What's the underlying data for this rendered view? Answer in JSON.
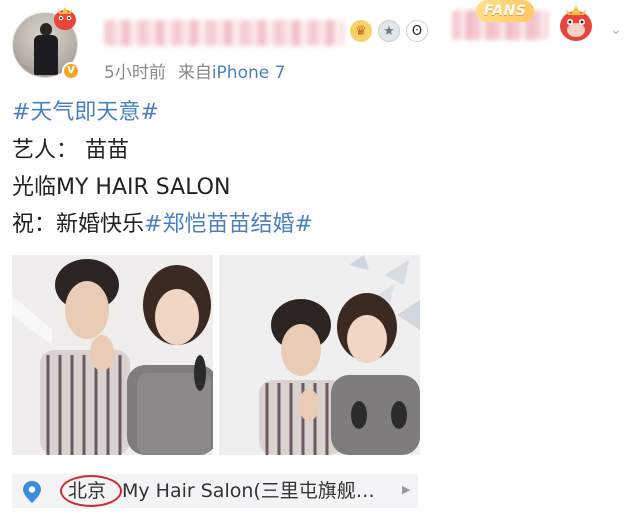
{
  "header": {
    "meta": {
      "time": "5小时前",
      "source_prefix": "来自",
      "source": "iPhone 7"
    },
    "fans_label": "FANS",
    "badges": [
      "crown-icon",
      "medal-icon",
      "panda-icon"
    ]
  },
  "post": {
    "lines": [
      {
        "text": "#天气即天意#"
      },
      {
        "text": "艺人：  苗苗"
      },
      {
        "text": "光临MY HAIR SALON"
      },
      {
        "prefix": "祝：新婚快乐",
        "topic": "#郑恺苗苗结婚#"
      }
    ]
  },
  "location": {
    "city": "北京",
    "place": "My Hair Salon(三里屯旗舰…"
  },
  "colors": {
    "link": "#4a7fc0",
    "meta": "#8a8a8a",
    "annotation_circle": "#d22b2b",
    "verified": "#f5a623"
  }
}
